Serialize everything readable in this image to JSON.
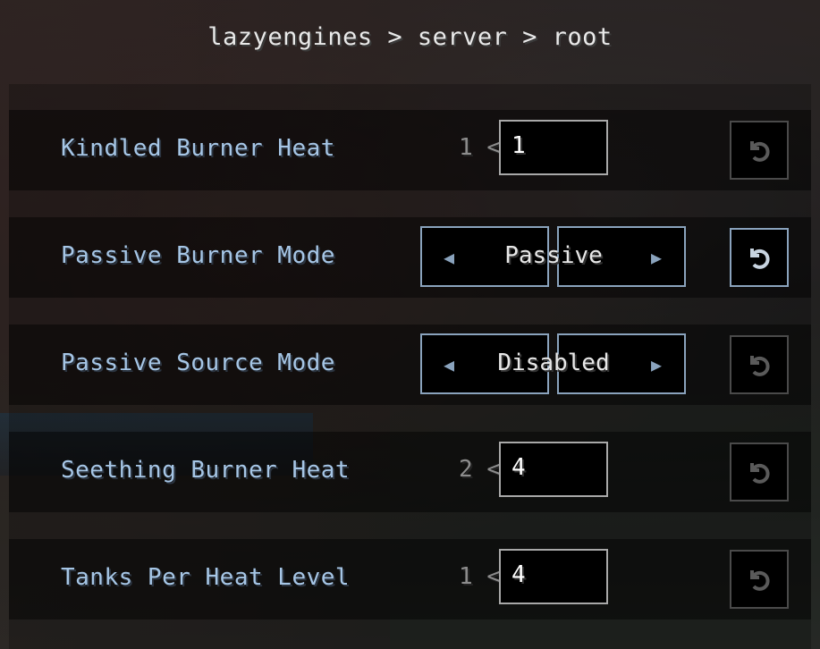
{
  "breadcrumb": "lazyengines > server > root",
  "settings": [
    {
      "label": "Kindled Burner Heat",
      "min_hint": "1 <",
      "value": "1",
      "reset_active": false
    },
    {
      "label": "Passive Burner Mode",
      "selected": "Passive",
      "reset_active": true
    },
    {
      "label": "Passive Source Mode",
      "selected": "Disabled",
      "reset_active": false
    },
    {
      "label": "Seething Burner Heat",
      "min_hint": "2 <",
      "value": "4",
      "reset_active": false
    },
    {
      "label": "Tanks Per Heat Level",
      "min_hint": "1 <",
      "value": "4",
      "reset_active": false
    }
  ],
  "icons": {
    "reset": "reset-icon",
    "prev": "arrow-left-icon",
    "next": "arrow-right-icon"
  },
  "colors": {
    "label": "#a6c6e6",
    "accent_border": "#8aa3bd",
    "input_border": "#a8a8a8"
  }
}
